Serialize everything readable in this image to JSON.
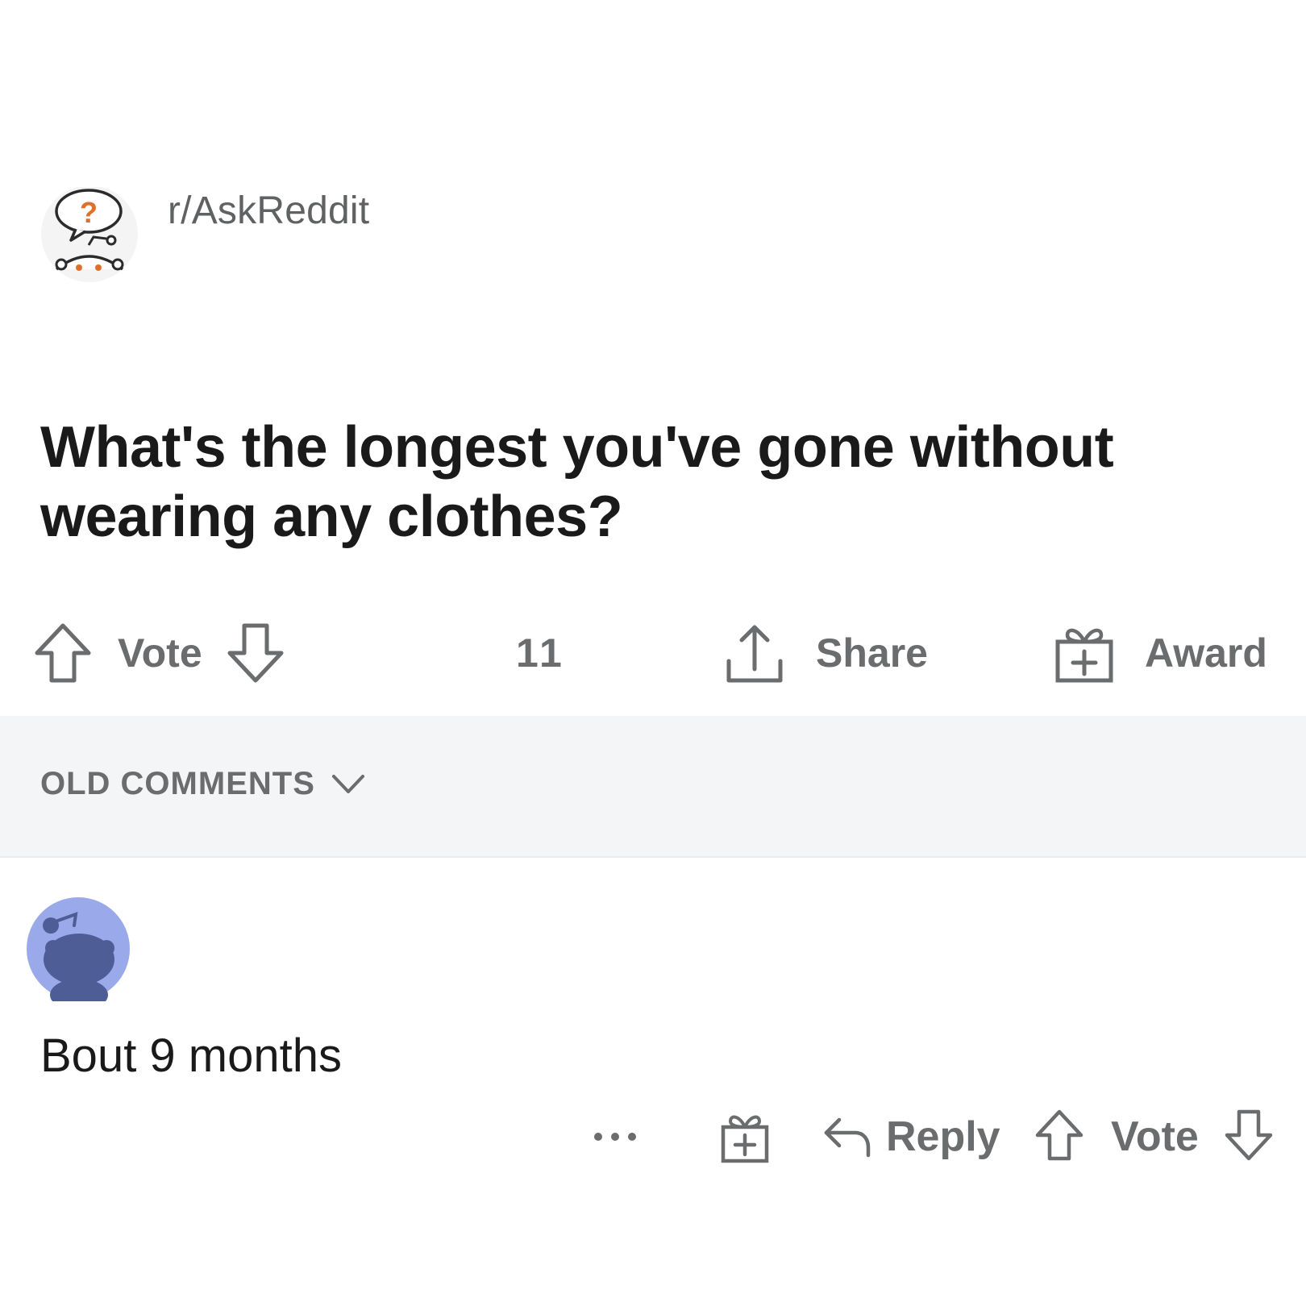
{
  "subreddit": {
    "name": "r/AskReddit",
    "icon": "askreddit-snoo-icon"
  },
  "post": {
    "title": "What's the longest you've gone without wearing any clothes?",
    "actions": {
      "vote_label": "Vote",
      "comment_count": "11",
      "share_label": "Share",
      "award_label": "Award"
    }
  },
  "comments_sort": {
    "label": "OLD COMMENTS",
    "icon": "chevron-down-icon"
  },
  "comment": {
    "avatar_icon": "snoo-avatar-icon",
    "body": "Bout 9 months",
    "actions": {
      "more_label": "•••",
      "reply_label": "Reply",
      "vote_label": "Vote"
    }
  },
  "colors": {
    "text_primary": "#1a1a1b",
    "text_secondary": "#6a6c6e",
    "sort_bar_bg": "#f4f5f6",
    "avatar_bg": "#9aa9e9",
    "askreddit_accent": "#e06f2c"
  }
}
